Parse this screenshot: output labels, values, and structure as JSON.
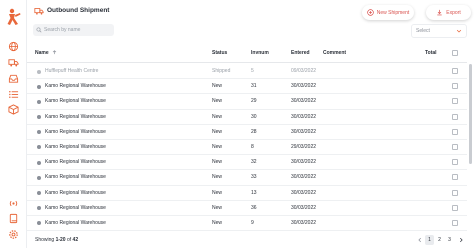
{
  "header": {
    "title": "Outbound Shipment",
    "new_shipment_label": "New Shipment",
    "export_label": "Export"
  },
  "toolbar": {
    "search_placeholder": "Search by name",
    "select_value": "Select"
  },
  "table": {
    "columns": {
      "name": "Name",
      "status": "Status",
      "invnum": "Invnum",
      "entered": "Entered",
      "comment": "Comment",
      "total": "Total"
    },
    "rows": [
      {
        "name": "Hufflepuff Health Centre",
        "status": "Shipped",
        "invnum": "5",
        "entered": "09/03/2022",
        "muted": true
      },
      {
        "name": "Kamo Regional Warehouse",
        "status": "New",
        "invnum": "31",
        "entered": "30/03/2022"
      },
      {
        "name": "Kamo Regional Warehouse",
        "status": "New",
        "invnum": "29",
        "entered": "30/03/2022"
      },
      {
        "name": "Kamo Regional Warehouse",
        "status": "New",
        "invnum": "30",
        "entered": "30/03/2022"
      },
      {
        "name": "Kamo Regional Warehouse",
        "status": "New",
        "invnum": "28",
        "entered": "30/03/2022"
      },
      {
        "name": "Kamo Regional Warehouse",
        "status": "New",
        "invnum": "8",
        "entered": "29/03/2022"
      },
      {
        "name": "Kamo Regional Warehouse",
        "status": "New",
        "invnum": "32",
        "entered": "30/03/2022"
      },
      {
        "name": "Kamo Regional Warehouse",
        "status": "New",
        "invnum": "33",
        "entered": "30/03/2022"
      },
      {
        "name": "Kamo Regional Warehouse",
        "status": "New",
        "invnum": "13",
        "entered": "30/03/2022"
      },
      {
        "name": "Kamo Regional Warehouse",
        "status": "New",
        "invnum": "36",
        "entered": "30/03/2022"
      },
      {
        "name": "Kamo Regional Warehouse",
        "status": "New",
        "invnum": "9",
        "entered": "30/03/2022"
      }
    ]
  },
  "footer": {
    "showing_prefix": "Showing",
    "showing_range": "1-20",
    "showing_of": "of",
    "showing_total": "42",
    "pages": [
      "1",
      "2",
      "3"
    ],
    "active_page": "1"
  },
  "icons": {
    "sidebar": [
      "globe-icon",
      "truck-icon",
      "inbox-icon",
      "list-icon",
      "box-icon",
      "radio-icon",
      "book-icon",
      "settings-icon"
    ]
  },
  "colors": {
    "accent": "#e8673a",
    "button_text": "#d9534f"
  }
}
